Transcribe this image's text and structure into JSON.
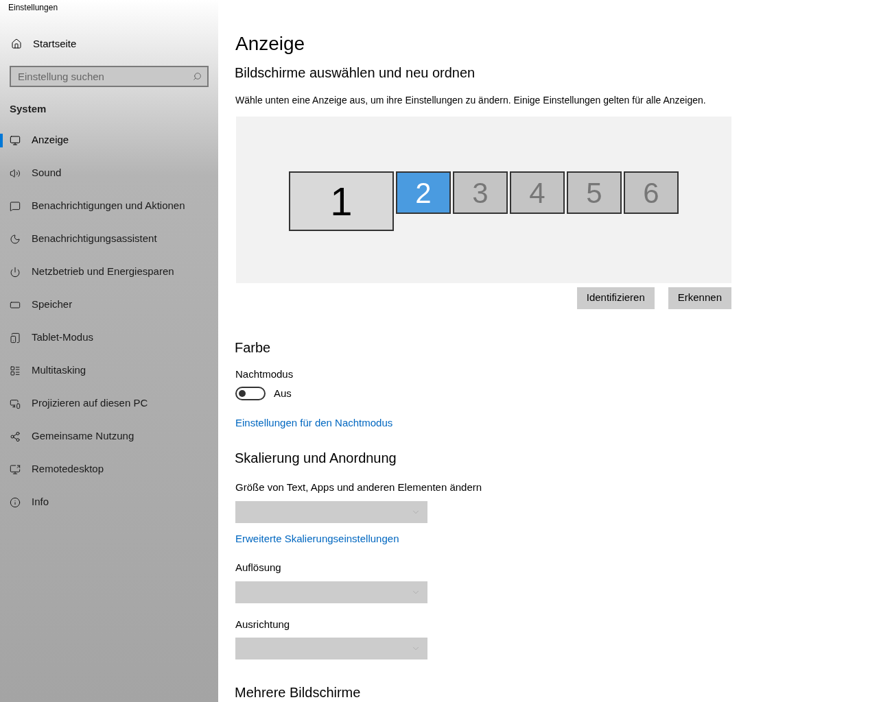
{
  "window": {
    "title": "Einstellungen"
  },
  "sidebar": {
    "home": "Startseite",
    "search": {
      "placeholder": "Einstellung suchen"
    },
    "section": "System",
    "items": [
      {
        "label": "Anzeige",
        "selected": true
      },
      {
        "label": "Sound",
        "selected": false
      },
      {
        "label": "Benachrichtigungen und Aktionen",
        "selected": false
      },
      {
        "label": "Benachrichtigungsassistent",
        "selected": false
      },
      {
        "label": "Netzbetrieb und Energiesparen",
        "selected": false
      },
      {
        "label": "Speicher",
        "selected": false
      },
      {
        "label": "Tablet-Modus",
        "selected": false
      },
      {
        "label": "Multitasking",
        "selected": false
      },
      {
        "label": "Projizieren auf diesen PC",
        "selected": false
      },
      {
        "label": "Gemeinsame Nutzung",
        "selected": false
      },
      {
        "label": "Remotedesktop",
        "selected": false
      },
      {
        "label": "Info",
        "selected": false
      }
    ]
  },
  "page": {
    "title": "Anzeige",
    "subtitle": "Bildschirme auswählen und neu ordnen",
    "description": "Wähle unten eine Anzeige aus, um ihre Einstellungen zu ändern. Einige Einstellungen gelten für alle Anzeigen.",
    "monitors": [
      {
        "label": "1",
        "kind": "large",
        "selected": false
      },
      {
        "label": "2",
        "kind": "small",
        "selected": true
      },
      {
        "label": "3",
        "kind": "small",
        "selected": false
      },
      {
        "label": "4",
        "kind": "small",
        "selected": false
      },
      {
        "label": "5",
        "kind": "small",
        "selected": false
      },
      {
        "label": "6",
        "kind": "small",
        "selected": false
      }
    ],
    "buttons": [
      "Identifizieren",
      "Erkennen"
    ],
    "color": {
      "heading": "Farbe",
      "night_mode": {
        "label": "Nachtmodus",
        "on": false,
        "state_text": "Aus"
      },
      "link": "Einstellungen für den Nachtmodus"
    },
    "scaling": {
      "heading": "Skalierung und Anordnung",
      "fields": [
        {
          "kind": "dropdown",
          "label": "Größe von Text, Apps und anderen Elementen ändern",
          "disabled": true
        },
        {
          "kind": "link",
          "label": "Erweiterte Skalierungseinstellungen"
        },
        {
          "kind": "dropdown",
          "label": "Auflösung",
          "disabled": true
        },
        {
          "kind": "dropdown",
          "label": "Ausrichtung",
          "disabled": true
        }
      ]
    },
    "next_heading": "Mehrere Bildschirme"
  }
}
